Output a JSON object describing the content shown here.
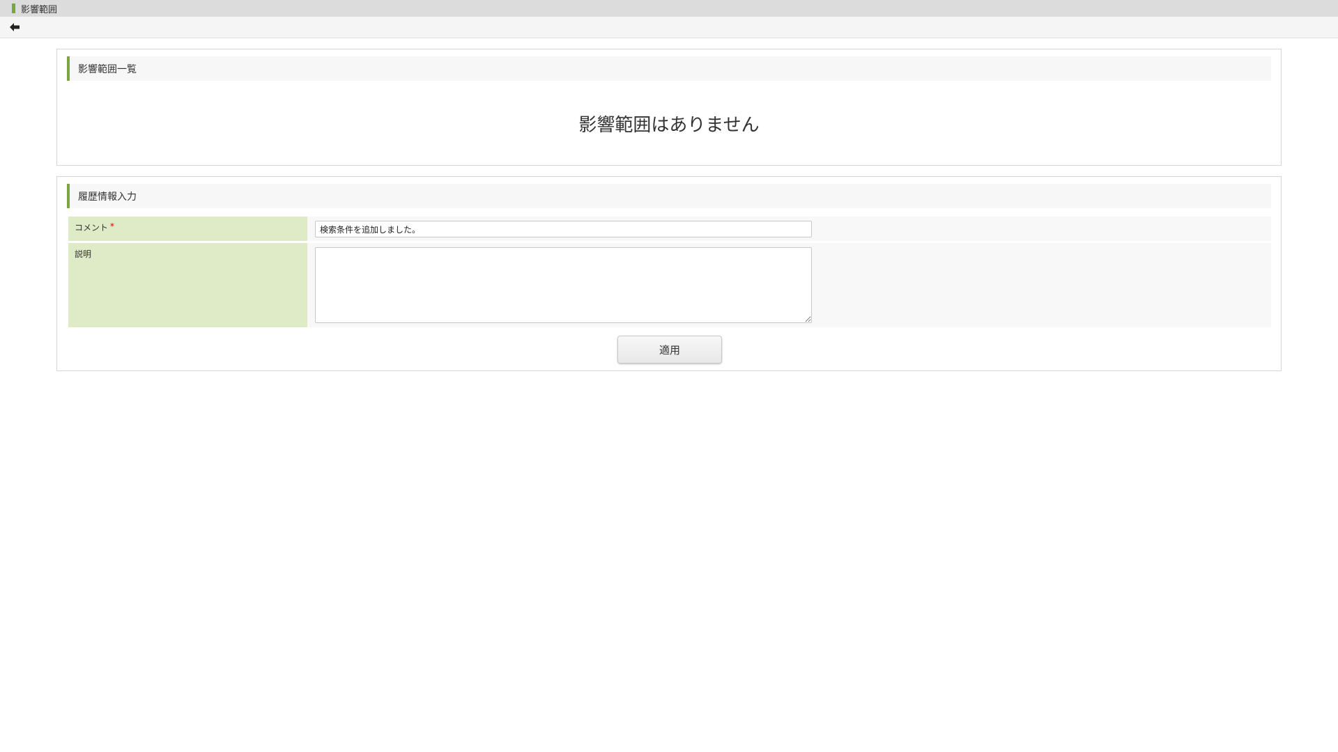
{
  "window": {
    "title": "影響範囲"
  },
  "toolbar": {
    "back_icon": "arrow-left-icon"
  },
  "impact_section": {
    "title": "影響範囲一覧",
    "empty_message": "影響範囲はありません"
  },
  "history_section": {
    "title": "履歴情報入力",
    "comment": {
      "label": "コメント",
      "required_mark": "*",
      "value": "検索条件を追加しました。"
    },
    "description": {
      "label": "説明",
      "value": ""
    },
    "apply_label": "適用"
  },
  "colors": {
    "accent": "#7ca53f",
    "label_background": "#dfeac6",
    "required": "#d20000"
  }
}
